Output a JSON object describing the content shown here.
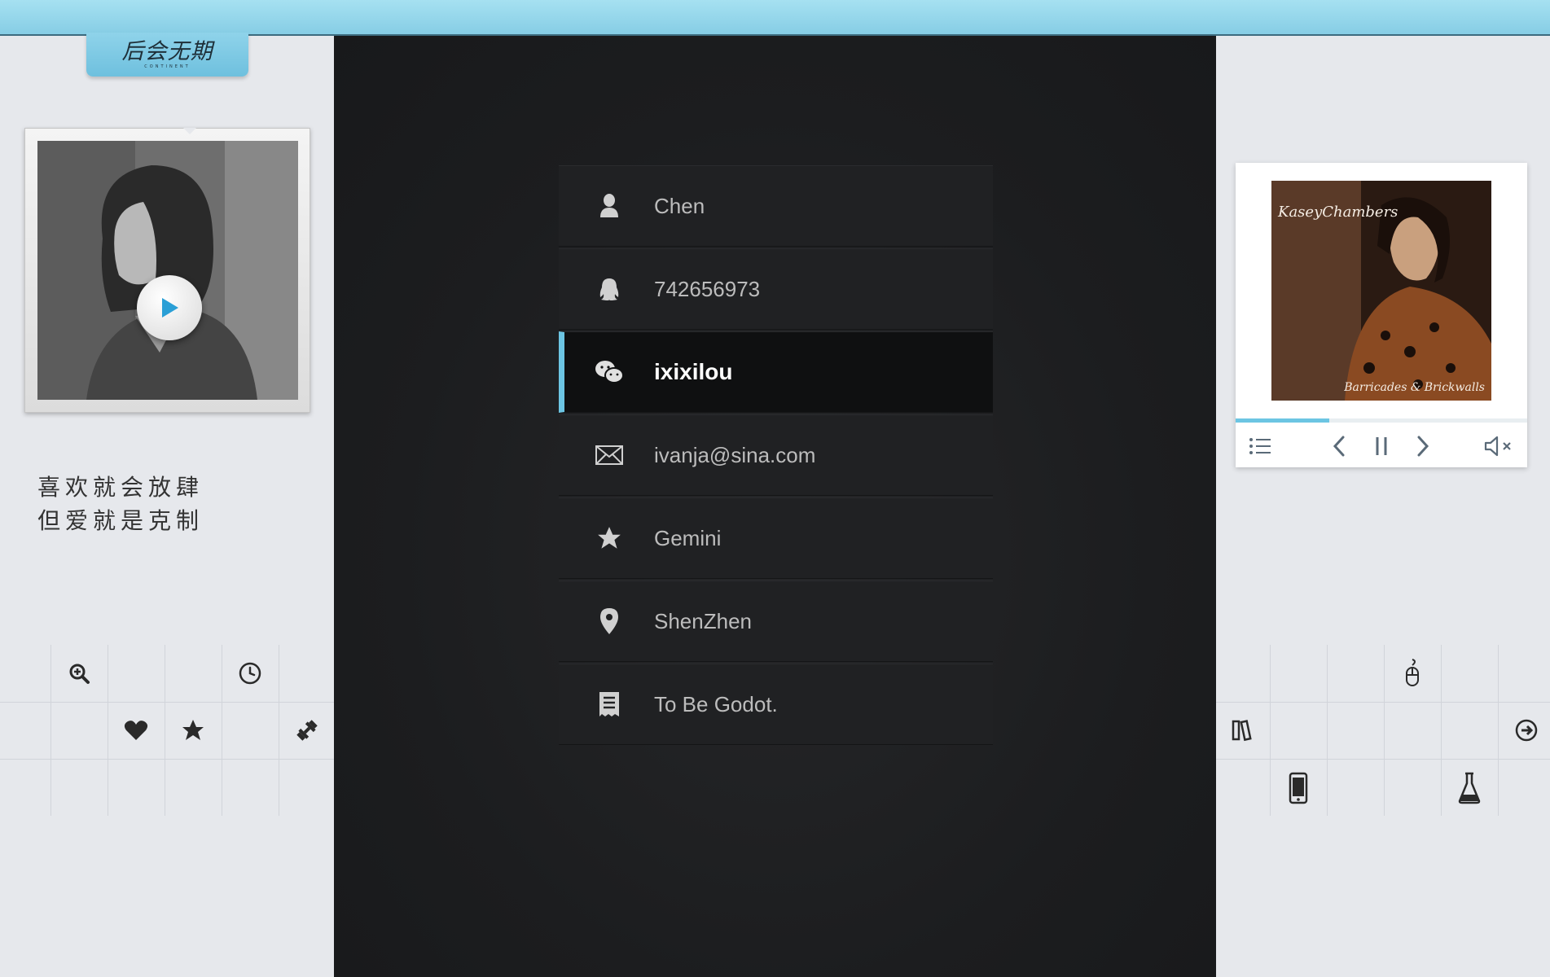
{
  "header": {
    "logo_text": "后会无期",
    "logo_sub": "CONTINENT"
  },
  "left": {
    "photo_alt": "girl portrait",
    "quote_lines": [
      "喜欢就会放肆",
      "但爱就是克制"
    ],
    "icons": [
      "zoom-in-icon",
      "clock-icon",
      "heart-icon",
      "star-icon",
      "dumbbell-icon"
    ]
  },
  "profile": {
    "rows": [
      {
        "icon": "user-icon",
        "text": "Chen"
      },
      {
        "icon": "qq-icon",
        "text": "742656973"
      },
      {
        "icon": "wechat-icon",
        "text": "ixixilou",
        "active": true
      },
      {
        "icon": "mail-icon",
        "text": "ivanja@sina.com"
      },
      {
        "icon": "star-icon",
        "text": "Gemini"
      },
      {
        "icon": "location-icon",
        "text": "ShenZhen"
      },
      {
        "icon": "note-icon",
        "text": "To Be Godot."
      }
    ]
  },
  "player": {
    "album_title": "KaseyChambers",
    "album_subtitle": "Barricades & Brickwalls",
    "progress": 0.32,
    "icons": [
      "playlist-icon",
      "previous-icon",
      "pause-icon",
      "next-icon",
      "mute-icon"
    ]
  },
  "right": {
    "icons": [
      "mouse-icon",
      "books-icon",
      "arrow-right-circle-icon",
      "phone-icon",
      "flask-icon"
    ]
  },
  "colors": {
    "accent": "#6cc5e3",
    "topbar": "#8fd3ea",
    "center_bg": "#1e1f21"
  }
}
